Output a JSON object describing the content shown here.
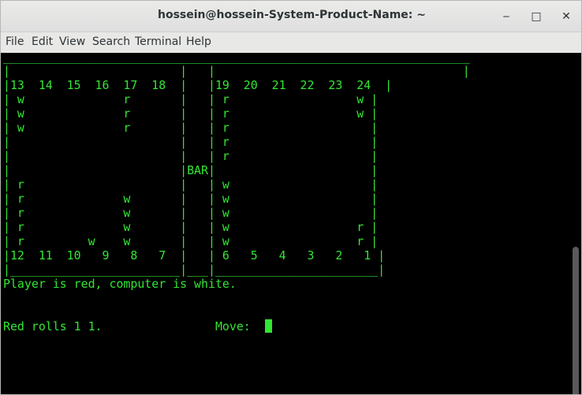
{
  "window": {
    "title": "hossein@hossein-System-Product-Name: ~",
    "minimize_glyph": "‒",
    "maximize_glyph": "□",
    "close_glyph": "✕"
  },
  "menu": [
    "File",
    "Edit",
    "View",
    "Search",
    "Terminal",
    "Help"
  ],
  "terminal": {
    "lines": [
      "__________________________________________________________________",
      "|                        |   |                                   |",
      "|13  14  15  16  17  18  |   |19  20  21  22  23  24  |",
      "| w              r       |   | r                  w |",
      "| w              r       |   | r                  w |",
      "| w              r       |   | r                    |",
      "|                        |   | r                    |",
      "|                        |   | r                    |",
      "|                        |BAR|                      |",
      "| r                      |   | w                    |",
      "| r              w       |   | w                    |",
      "| r              w       |   | w                    |",
      "| r              w       |   | w                  r |",
      "| r         w    w       |   | w                  r |",
      "|12  11  10   9   8   7  |   | 6   5   4   3   2   1 |",
      "|________________________|___|_______________________|",
      "Player is red, computer is white.",
      "",
      "",
      "Red rolls 1 1.                Move:  "
    ],
    "accent_color": "#33e633"
  }
}
